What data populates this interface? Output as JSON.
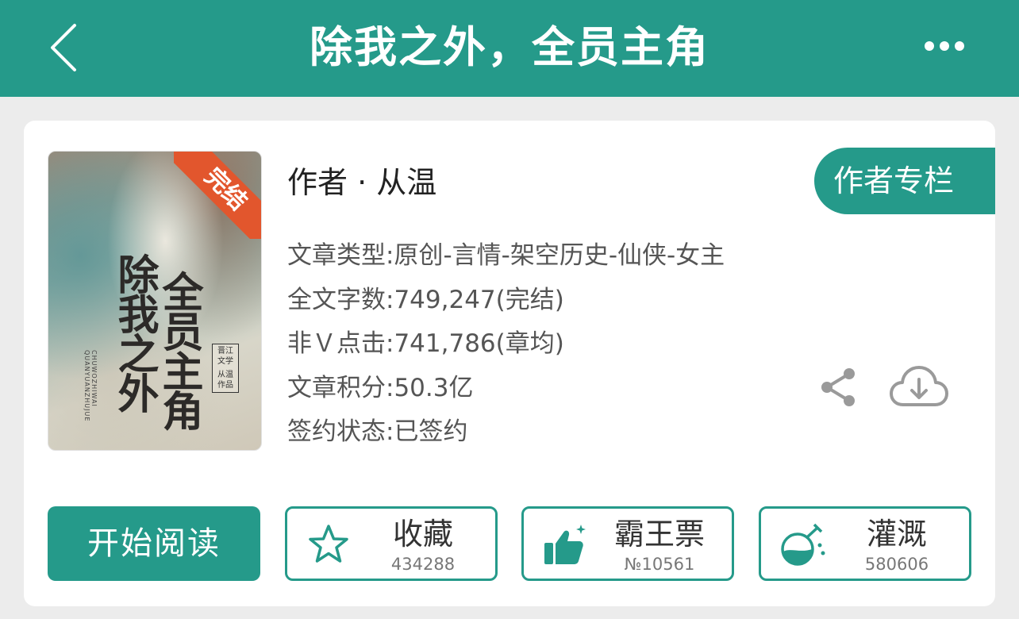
{
  "header": {
    "title": "除我之外，全员主角",
    "back_icon": "chevron-left-icon",
    "more_icon": "more-dots-icon"
  },
  "book": {
    "cover": {
      "badge": "完结",
      "title_line1": "除我之外",
      "title_line2": "全员主角",
      "pinyin": "CHUWOZHIWAI QUANYUANZHUJUE",
      "publisher_stamp": "晋江文学",
      "author_stamp": "从温作品"
    },
    "author_label": "作者 · 从温",
    "author_column_button": "作者专栏",
    "info": [
      "文章类型:原创-言情-架空历史-仙侠-女主",
      "全文字数:749,247(完结)",
      "非Ｖ点击:741,786(章均)",
      "文章积分:50.3亿",
      "签约状态:已签约"
    ]
  },
  "actions": {
    "read_button": "开始阅读",
    "favorite": {
      "label": "收藏",
      "count": "434288",
      "icon": "star-icon"
    },
    "overlord_ticket": {
      "label": "霸王票",
      "count": "№10561",
      "icon": "thumbs-up-icon"
    },
    "nourish": {
      "label": "灌溉",
      "count": "580606",
      "icon": "flask-icon"
    },
    "share_icon": "share-icon",
    "download_icon": "cloud-download-icon"
  },
  "colors": {
    "brand": "#259a8a",
    "badge": "#e2562d",
    "background": "#ececec"
  }
}
